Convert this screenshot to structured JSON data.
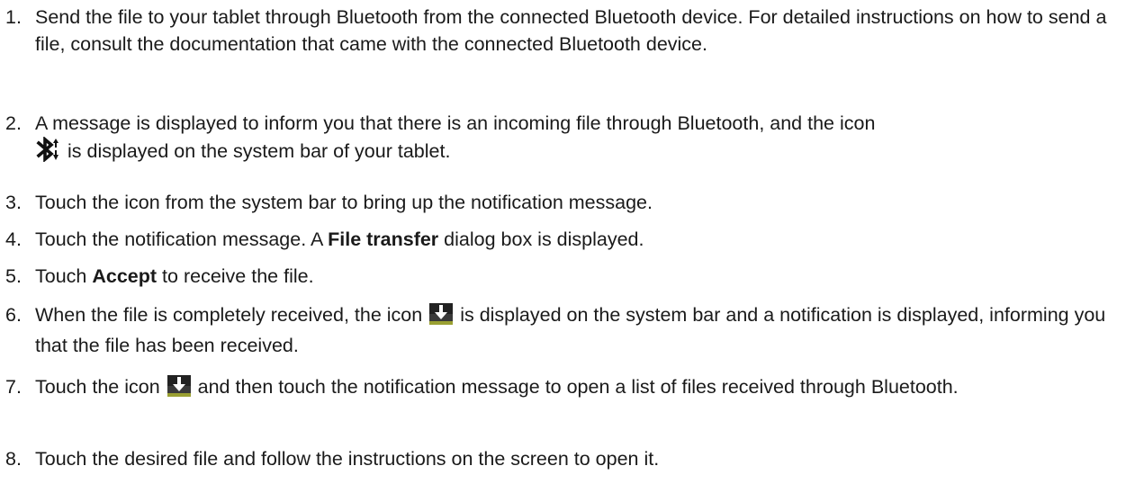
{
  "steps": [
    {
      "num": "1.",
      "text": "Send the file to your tablet through Bluetooth from the connected Bluetooth device. For detailed instructions on how to send a file, consult the documentation that came with the connected Bluetooth device."
    },
    {
      "num": "2.",
      "text_a": "A message is displayed to inform you that there is an incoming file through Bluetooth, and the icon",
      "icon": "bluetooth-transfer-icon",
      "text_b": "is displayed on the system bar of your tablet."
    },
    {
      "num": "3.",
      "text": "Touch the icon from the system bar to bring up the notification message."
    },
    {
      "num": "4.",
      "text_a": "Touch the notification message. A",
      "bold": "File transfer",
      "text_b": "dialog box is displayed."
    },
    {
      "num": "5.",
      "text_a": "Touch",
      "bold": "Accept",
      "text_b": "to receive the file."
    },
    {
      "num": "6.",
      "text_a": "When the file is completely received, the icon",
      "icon": "download-complete-icon",
      "text_b": "is displayed on the system bar and a notification is displayed, informing you that the file has been received."
    },
    {
      "num": "7.",
      "text_a": "Touch the icon",
      "icon": "download-complete-icon",
      "text_b": "and then touch the notification message to open a list of files received through Bluetooth."
    },
    {
      "num": "8.",
      "text": "Touch the desired file and follow the instructions on the screen to open it."
    }
  ]
}
